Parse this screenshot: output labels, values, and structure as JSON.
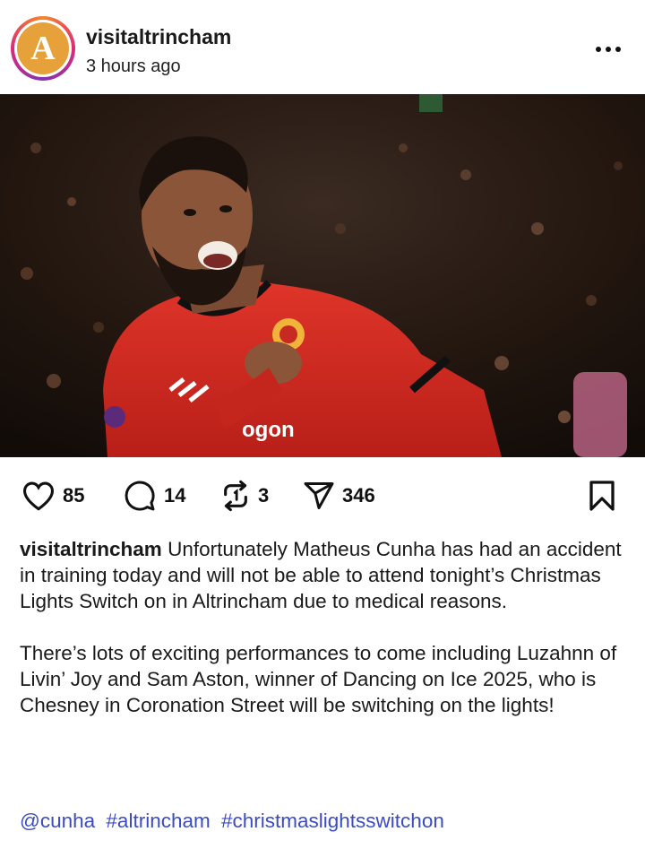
{
  "post": {
    "username": "visitaltrincham",
    "time": "3 hours ago",
    "avatar_letter": "A",
    "avatar_color": "#e6a13a",
    "photo_sponsor_text": "ogon"
  },
  "actions": {
    "likes": "85",
    "comments": "14",
    "reposts": "3",
    "shares": "346"
  },
  "caption": {
    "username": "visitaltrincham",
    "paragraph1": "Unfortunately Matheus Cunha has had an accident in training today and will not be able to attend tonight’s Christmas Lights Switch on in Altrincham due to medical reasons.",
    "paragraph2": "There’s lots of exciting performances to come including Luzahnn of Livin’ Joy and Sam Aston, winner of Dancing on Ice 2025, who is Chesney in Coronation Street will be switching on the lights!",
    "tags": [
      "@cunha",
      "#altrincham",
      "#christmaslightsswitchon"
    ]
  },
  "colors": {
    "link": "#3b4cc0",
    "shirt": "#d42a20"
  }
}
